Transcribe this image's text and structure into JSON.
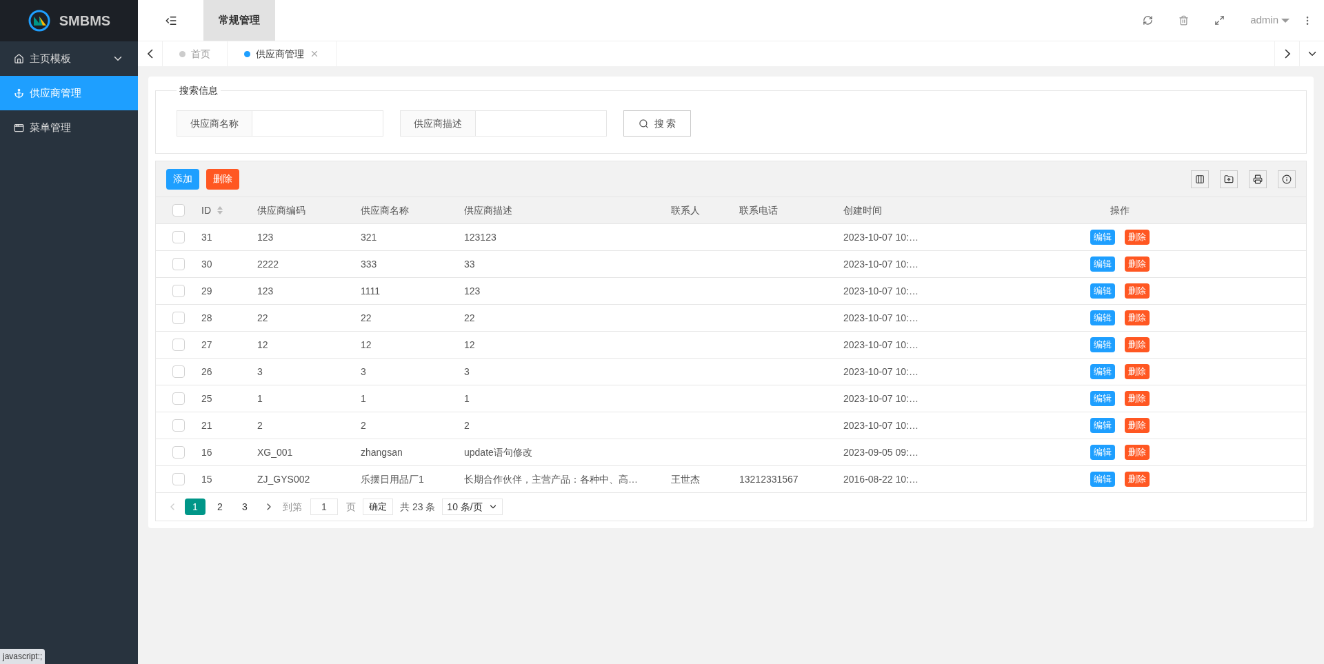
{
  "brand": {
    "name": "SMBMS"
  },
  "sidebar": {
    "items": [
      {
        "label": "主页模板",
        "selected": false,
        "expandable": true
      },
      {
        "label": "供应商管理",
        "selected": true,
        "expandable": false
      },
      {
        "label": "菜单管理",
        "selected": false,
        "expandable": false
      }
    ]
  },
  "header": {
    "menu_tab": "常规管理",
    "user": "admin"
  },
  "page_tabs": [
    {
      "label": "首页",
      "selected": false,
      "closable": false
    },
    {
      "label": "供应商管理",
      "selected": true,
      "closable": true
    }
  ],
  "search": {
    "legend": "搜索信息",
    "fields": [
      {
        "label": "供应商名称"
      },
      {
        "label": "供应商描述"
      }
    ],
    "button": "搜 索"
  },
  "toolbar": {
    "add": "添加",
    "delete": "删除"
  },
  "table": {
    "select_all_checked": false,
    "columns": [
      "ID",
      "供应商编码",
      "供应商名称",
      "供应商描述",
      "联系人",
      "联系电话",
      "创建时间",
      "操作"
    ],
    "rows": [
      {
        "checked": false,
        "cells": [
          "31",
          "123",
          "321",
          "123123",
          "",
          "",
          "2023-10-07 10:…"
        ],
        "actions": [
          "编辑",
          "删除"
        ]
      },
      {
        "checked": false,
        "cells": [
          "30",
          "2222",
          "333",
          "33",
          "",
          "",
          "2023-10-07 10:…"
        ],
        "actions": [
          "编辑",
          "删除"
        ]
      },
      {
        "checked": false,
        "cells": [
          "29",
          "123",
          "1111",
          "123",
          "",
          "",
          "2023-10-07 10:…"
        ],
        "actions": [
          "编辑",
          "删除"
        ]
      },
      {
        "checked": false,
        "cells": [
          "28",
          "22",
          "22",
          "22",
          "",
          "",
          "2023-10-07 10:…"
        ],
        "actions": [
          "编辑",
          "删除"
        ]
      },
      {
        "checked": false,
        "cells": [
          "27",
          "12",
          "12",
          "12",
          "",
          "",
          "2023-10-07 10:…"
        ],
        "actions": [
          "编辑",
          "删除"
        ]
      },
      {
        "checked": false,
        "cells": [
          "26",
          "3",
          "3",
          "3",
          "",
          "",
          "2023-10-07 10:…"
        ],
        "actions": [
          "编辑",
          "删除"
        ]
      },
      {
        "checked": false,
        "cells": [
          "25",
          "1",
          "1",
          "1",
          "",
          "",
          "2023-10-07 10:…"
        ],
        "actions": [
          "编辑",
          "删除"
        ]
      },
      {
        "checked": false,
        "cells": [
          "21",
          "2",
          "2",
          "2",
          "",
          "",
          "2023-10-07 10:…"
        ],
        "actions": [
          "编辑",
          "删除"
        ]
      },
      {
        "checked": false,
        "cells": [
          "16",
          "XG_001",
          "zhangsan",
          "update语句修改",
          "",
          "",
          "2023-09-05 09:…"
        ],
        "actions": [
          "编辑",
          "删除"
        ]
      },
      {
        "checked": false,
        "cells": [
          "15",
          "ZJ_GYS002",
          "乐摆日用品厂1",
          "长期合作伙伴，主营产品：各种中、高…",
          "王世杰",
          "13212331567",
          "2016-08-22 10:…"
        ],
        "actions": [
          "编辑",
          "删除"
        ]
      }
    ]
  },
  "pagination": {
    "pages": [
      {
        "label": "1",
        "selected": true
      },
      {
        "label": "2",
        "selected": false
      },
      {
        "label": "3",
        "selected": false
      }
    ],
    "goto_label": "到第",
    "goto_value": "1",
    "page_unit": "页",
    "confirm": "确定",
    "total": "共 23 条",
    "page_size": "10 条/页"
  },
  "status_bar": "javascript:;"
}
